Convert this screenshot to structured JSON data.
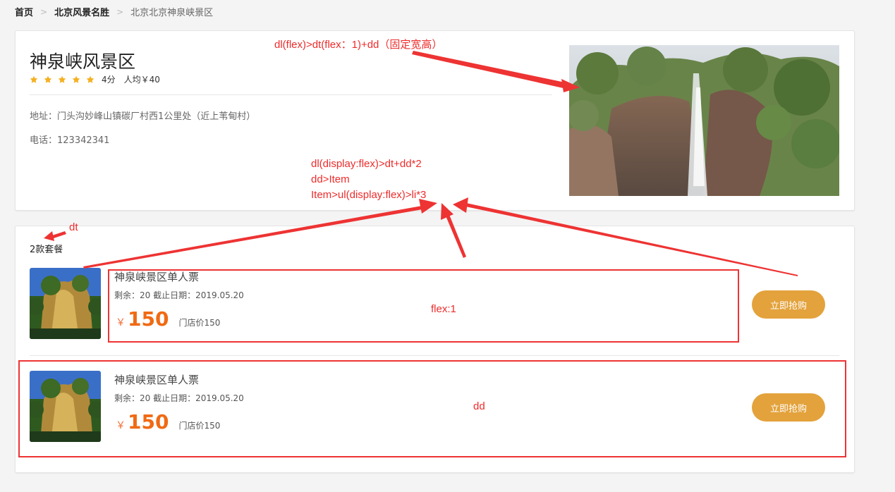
{
  "breadcrumb": {
    "home": "首页",
    "category": "北京风景名胜",
    "current": "北京北京神泉峡景区"
  },
  "scenic": {
    "name": "神泉峡风景区",
    "stars": 5,
    "score": "4分",
    "avg_price": "人均￥40",
    "address": "地址：门头沟妙峰山镇碳厂村西1公里处（近上苇甸村）",
    "phone": "电话：123342341"
  },
  "packages": {
    "count_label": "2款套餐",
    "items": [
      {
        "name": "神泉峡景区单人票",
        "meta": "剩余：20 截止日期：2019.05.20",
        "currency": "￥",
        "price": "150",
        "store_price": "门店价150",
        "buy_label": "立即抢购"
      },
      {
        "name": "神泉峡景区单人票",
        "meta": "剩余：20 截止日期：2019.05.20",
        "currency": "￥",
        "price": "150",
        "store_price": "门店价150",
        "buy_label": "立即抢购"
      }
    ]
  },
  "annotations": {
    "top": "dl(flex)>dt(flex：1)+dd（固定宽高）",
    "middle_1": "dl(display:flex)>dt+dd*2",
    "middle_2": "dd>Item",
    "middle_3": "Item>ul(display:flex)>li*3",
    "dt": "dt",
    "flex": "flex:1",
    "dd": "dd"
  },
  "colors": {
    "accent_orange": "#f06a14",
    "button": "#e3a23b",
    "star": "#f5b021",
    "annotation_red": "#ee2b2b"
  }
}
